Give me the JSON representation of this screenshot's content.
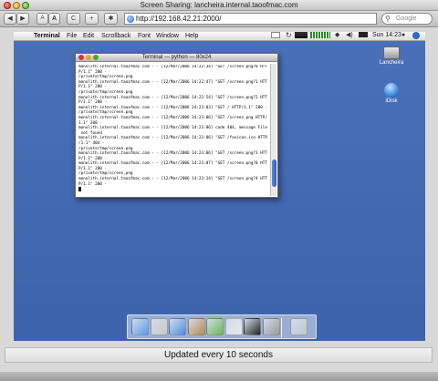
{
  "window": {
    "title": "Screen Sharing: lancheira.internal.taoofmac.com"
  },
  "toolbar": {
    "back_label": "◀",
    "forward_label": "▶",
    "text_smaller": "A",
    "text_larger": "A",
    "reload_label": "C",
    "add_label": "+",
    "settings_label": "✱",
    "url": "http://192.168.42.21:2000/",
    "search_placeholder": "Google"
  },
  "remote_menubar": {
    "app": "Terminal",
    "items": [
      "File",
      "Edit",
      "Scrollback",
      "Font",
      "Window",
      "Help"
    ],
    "clock": "Sun 14:23"
  },
  "desktop_icons": [
    {
      "name": "Lancheira",
      "icon": "hard-drive-icon"
    },
    {
      "name": "iDisk",
      "icon": "idisk-icon"
    }
  ],
  "terminal": {
    "title": "Terminal — python — 80x24",
    "lines": [
      "monolith.internal.taoofmac.com - - [12/Mar/2006 14:22:34] \"GET /screen.png?0 HTT",
      "P/1.1\" 200 -",
      "/private/tmp/screen.png",
      "monolith.internal.taoofmac.com - - [12/Mar/2006 14:22:47] \"GET /screen.png?1 HTT",
      "P/1.1\" 200 -",
      "/private/tmp/screen.png",
      "monolith.internal.taoofmac.com - - [12/Mar/2006 14:22:54] \"GET /screen.png?2 HTT",
      "P/1.1\" 200 -",
      "monolith.internal.taoofmac.com - - [12/Mar/2006 14:23:03] \"GET / HTTP/1.1\" 200 -",
      "/private/tmp/screen.png",
      "monolith.internal.taoofmac.com - - [12/Mar/2006 14:23:06] \"GET /screen.png HTTP/",
      "1.1\" 200 -",
      "monolith.internal.taoofmac.com - - [12/Mar/2006 14:23:06] code 404, message File",
      " not found",
      "monolith.internal.taoofmac.com - - [12/Mar/2006 14:23:06] \"GET /favicon.ico HTTP",
      "/1.1\" 404 -",
      "/private/tmp/screen.png",
      "monolith.internal.taoofmac.com - - [12/Mar/2006 14:23:06] \"GET /screen.png?3 HTT",
      "P/1.1\" 200 -",
      "monolith.internal.taoofmac.com - - [12/Mar/2006 14:23:07] \"GET /screen.png?0 HTT",
      "P/1.1\" 200 -",
      "/private/tmp/screen.png",
      "monolith.internal.taoofmac.com - - [12/Mar/2006 14:23:14] \"GET /screen.png?4 HTT",
      "P/1.1\" 200 -"
    ]
  },
  "dock": {
    "items": [
      {
        "name": "finder-icon",
        "color": "#5a9ae8"
      },
      {
        "name": "mail-icon",
        "color": "#c8c8c8"
      },
      {
        "name": "safari-icon",
        "color": "#4a8ee0"
      },
      {
        "name": "address-book-icon",
        "color": "#b88a4a"
      },
      {
        "name": "itunes-icon",
        "color": "#6ab84a"
      },
      {
        "name": "ical-icon",
        "color": "#e8e8e8"
      },
      {
        "name": "terminal-icon",
        "color": "#222222"
      },
      {
        "name": "system-preferences-icon",
        "color": "#9a9a9a"
      },
      {
        "name": "trash-icon",
        "color": "#c0c8d0"
      }
    ]
  },
  "status": {
    "text": "Updated every 10 seconds"
  }
}
